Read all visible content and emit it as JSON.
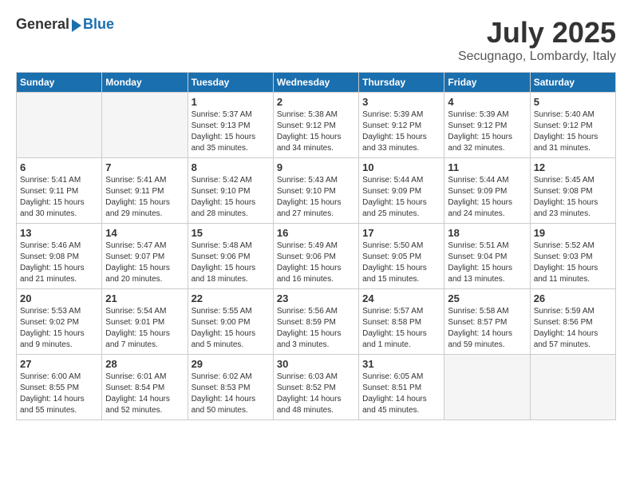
{
  "header": {
    "logo_general": "General",
    "logo_blue": "Blue",
    "month_year": "July 2025",
    "location": "Secugnago, Lombardy, Italy"
  },
  "days_of_week": [
    "Sunday",
    "Monday",
    "Tuesday",
    "Wednesday",
    "Thursday",
    "Friday",
    "Saturday"
  ],
  "weeks": [
    [
      {
        "day": "",
        "info": ""
      },
      {
        "day": "",
        "info": ""
      },
      {
        "day": "1",
        "info": "Sunrise: 5:37 AM\nSunset: 9:13 PM\nDaylight: 15 hours\nand 35 minutes."
      },
      {
        "day": "2",
        "info": "Sunrise: 5:38 AM\nSunset: 9:12 PM\nDaylight: 15 hours\nand 34 minutes."
      },
      {
        "day": "3",
        "info": "Sunrise: 5:39 AM\nSunset: 9:12 PM\nDaylight: 15 hours\nand 33 minutes."
      },
      {
        "day": "4",
        "info": "Sunrise: 5:39 AM\nSunset: 9:12 PM\nDaylight: 15 hours\nand 32 minutes."
      },
      {
        "day": "5",
        "info": "Sunrise: 5:40 AM\nSunset: 9:12 PM\nDaylight: 15 hours\nand 31 minutes."
      }
    ],
    [
      {
        "day": "6",
        "info": "Sunrise: 5:41 AM\nSunset: 9:11 PM\nDaylight: 15 hours\nand 30 minutes."
      },
      {
        "day": "7",
        "info": "Sunrise: 5:41 AM\nSunset: 9:11 PM\nDaylight: 15 hours\nand 29 minutes."
      },
      {
        "day": "8",
        "info": "Sunrise: 5:42 AM\nSunset: 9:10 PM\nDaylight: 15 hours\nand 28 minutes."
      },
      {
        "day": "9",
        "info": "Sunrise: 5:43 AM\nSunset: 9:10 PM\nDaylight: 15 hours\nand 27 minutes."
      },
      {
        "day": "10",
        "info": "Sunrise: 5:44 AM\nSunset: 9:09 PM\nDaylight: 15 hours\nand 25 minutes."
      },
      {
        "day": "11",
        "info": "Sunrise: 5:44 AM\nSunset: 9:09 PM\nDaylight: 15 hours\nand 24 minutes."
      },
      {
        "day": "12",
        "info": "Sunrise: 5:45 AM\nSunset: 9:08 PM\nDaylight: 15 hours\nand 23 minutes."
      }
    ],
    [
      {
        "day": "13",
        "info": "Sunrise: 5:46 AM\nSunset: 9:08 PM\nDaylight: 15 hours\nand 21 minutes."
      },
      {
        "day": "14",
        "info": "Sunrise: 5:47 AM\nSunset: 9:07 PM\nDaylight: 15 hours\nand 20 minutes."
      },
      {
        "day": "15",
        "info": "Sunrise: 5:48 AM\nSunset: 9:06 PM\nDaylight: 15 hours\nand 18 minutes."
      },
      {
        "day": "16",
        "info": "Sunrise: 5:49 AM\nSunset: 9:06 PM\nDaylight: 15 hours\nand 16 minutes."
      },
      {
        "day": "17",
        "info": "Sunrise: 5:50 AM\nSunset: 9:05 PM\nDaylight: 15 hours\nand 15 minutes."
      },
      {
        "day": "18",
        "info": "Sunrise: 5:51 AM\nSunset: 9:04 PM\nDaylight: 15 hours\nand 13 minutes."
      },
      {
        "day": "19",
        "info": "Sunrise: 5:52 AM\nSunset: 9:03 PM\nDaylight: 15 hours\nand 11 minutes."
      }
    ],
    [
      {
        "day": "20",
        "info": "Sunrise: 5:53 AM\nSunset: 9:02 PM\nDaylight: 15 hours\nand 9 minutes."
      },
      {
        "day": "21",
        "info": "Sunrise: 5:54 AM\nSunset: 9:01 PM\nDaylight: 15 hours\nand 7 minutes."
      },
      {
        "day": "22",
        "info": "Sunrise: 5:55 AM\nSunset: 9:00 PM\nDaylight: 15 hours\nand 5 minutes."
      },
      {
        "day": "23",
        "info": "Sunrise: 5:56 AM\nSunset: 8:59 PM\nDaylight: 15 hours\nand 3 minutes."
      },
      {
        "day": "24",
        "info": "Sunrise: 5:57 AM\nSunset: 8:58 PM\nDaylight: 15 hours\nand 1 minute."
      },
      {
        "day": "25",
        "info": "Sunrise: 5:58 AM\nSunset: 8:57 PM\nDaylight: 14 hours\nand 59 minutes."
      },
      {
        "day": "26",
        "info": "Sunrise: 5:59 AM\nSunset: 8:56 PM\nDaylight: 14 hours\nand 57 minutes."
      }
    ],
    [
      {
        "day": "27",
        "info": "Sunrise: 6:00 AM\nSunset: 8:55 PM\nDaylight: 14 hours\nand 55 minutes."
      },
      {
        "day": "28",
        "info": "Sunrise: 6:01 AM\nSunset: 8:54 PM\nDaylight: 14 hours\nand 52 minutes."
      },
      {
        "day": "29",
        "info": "Sunrise: 6:02 AM\nSunset: 8:53 PM\nDaylight: 14 hours\nand 50 minutes."
      },
      {
        "day": "30",
        "info": "Sunrise: 6:03 AM\nSunset: 8:52 PM\nDaylight: 14 hours\nand 48 minutes."
      },
      {
        "day": "31",
        "info": "Sunrise: 6:05 AM\nSunset: 8:51 PM\nDaylight: 14 hours\nand 45 minutes."
      },
      {
        "day": "",
        "info": ""
      },
      {
        "day": "",
        "info": ""
      }
    ]
  ]
}
